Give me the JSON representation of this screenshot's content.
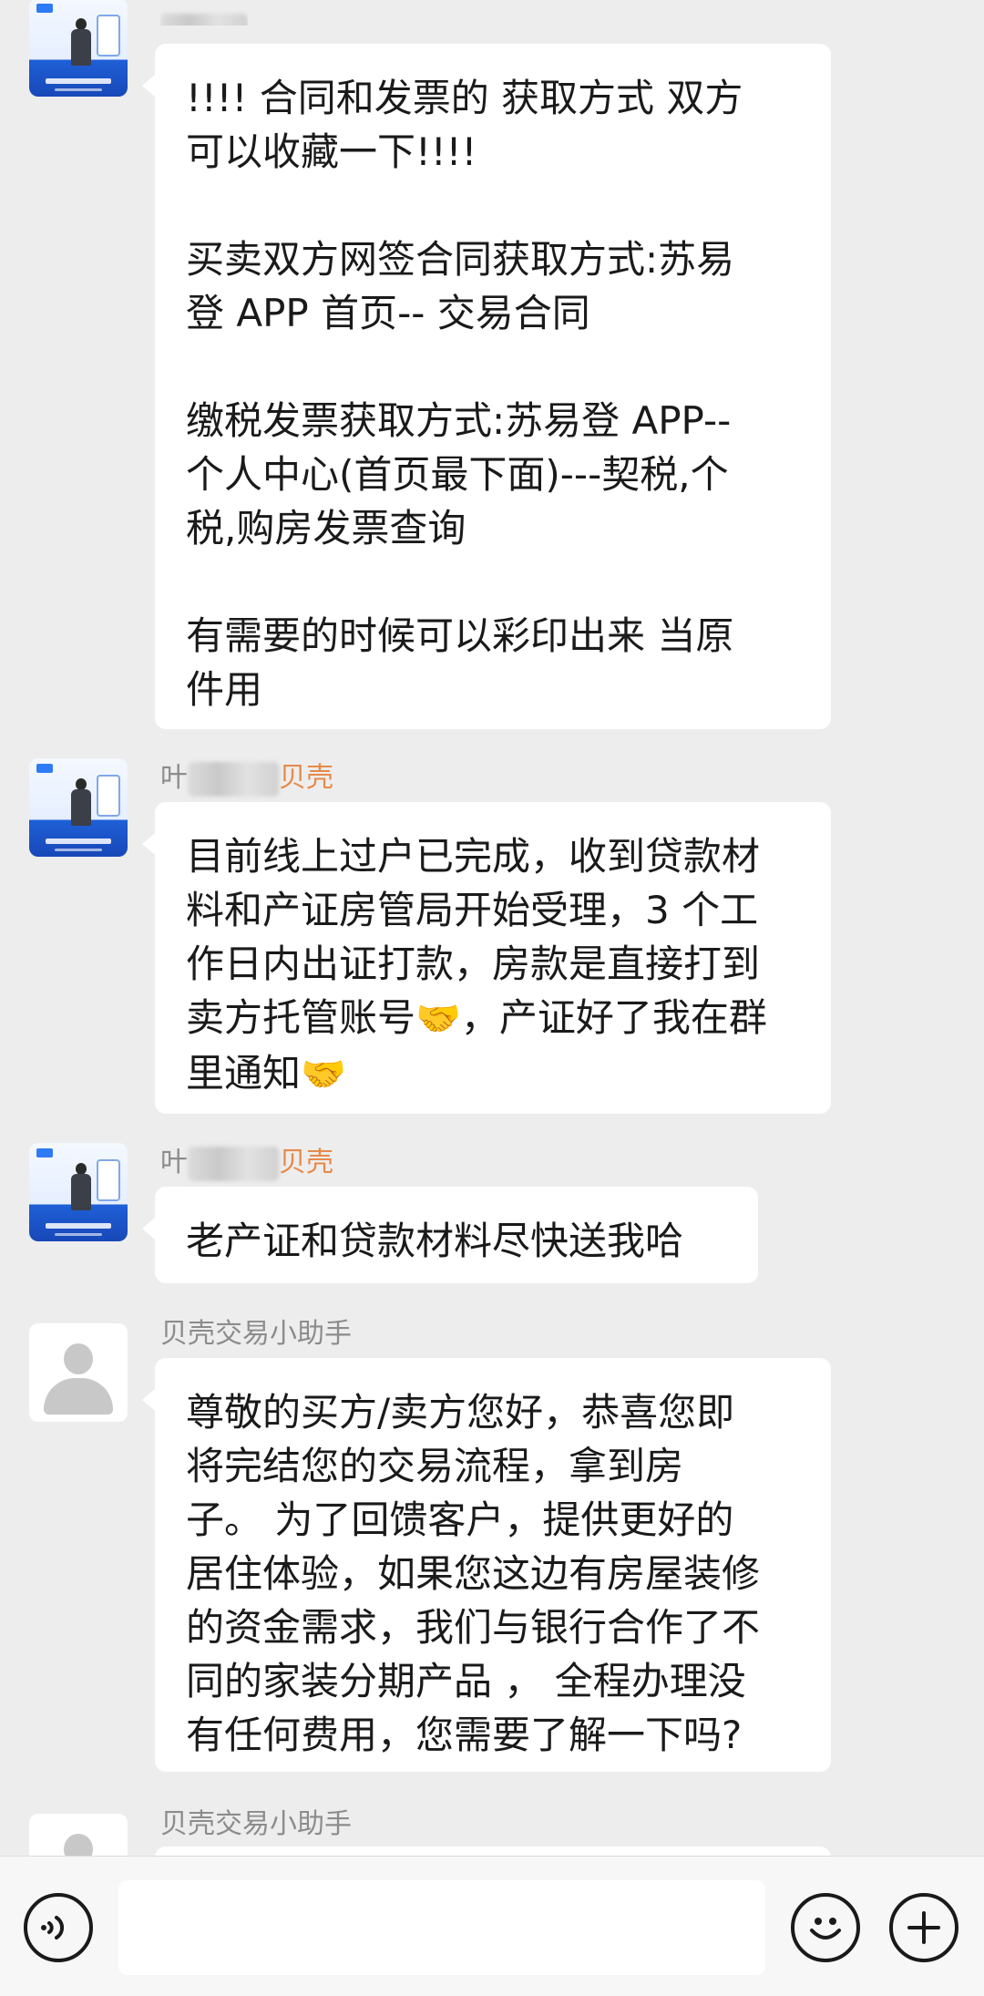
{
  "messages": [
    {
      "sender_name": "",
      "sender_org": "",
      "text": "!!!! 合同和发票的 获取方式 双方\n可以收藏一下!!!!\n\n买卖双方网签合同获取方式:苏易\n登 APP 首页-- 交易合同\n\n缴税发票获取方式:苏易登 APP--\n个人中心(首页最下面)---契税,个\n税,购房发票查询\n\n有需要的时候可以彩印出来 当原\n件用"
    },
    {
      "sender_name": "叶",
      "sender_org": "贝壳",
      "text_part1": "目前线上过户已完成，收到贷款材\n料和产证房管局开始受理，3 个工\n作日内出证打款，房款是直接打到\n卖方托管账号",
      "emoji1": "🤝",
      "text_part2": "，产证好了我在群\n里通知",
      "emoji2": "🤝"
    },
    {
      "sender_name": "叶",
      "sender_org": "贝壳",
      "text": "老产证和贷款材料尽快送我哈"
    },
    {
      "sender_name": "贝壳交易小助手",
      "text": "尊敬的买方/卖方您好，恭喜您即\n将完结您的交易流程，拿到房\n子。 为了回馈客户，提供更好的\n居住体验，如果您这边有房屋装修\n的资金需求，我们与银行合作了不\n同的家装分期产品 ， 全程办理没\n有任何费用，您需要了解一下吗?"
    },
    {
      "sender_name": "贝壳交易小助手",
      "text": ""
    }
  ],
  "input_bar": {
    "voice_icon": "voice-icon",
    "emoji_icon": "emoji-icon",
    "plus_icon": "plus-icon",
    "text_value": ""
  },
  "colors": {
    "background": "#ededed",
    "bubble": "#ffffff",
    "sender_gray": "#8c8c8c",
    "sender_org": "#e68a4a",
    "brand_blue": "#1f5fd6"
  }
}
